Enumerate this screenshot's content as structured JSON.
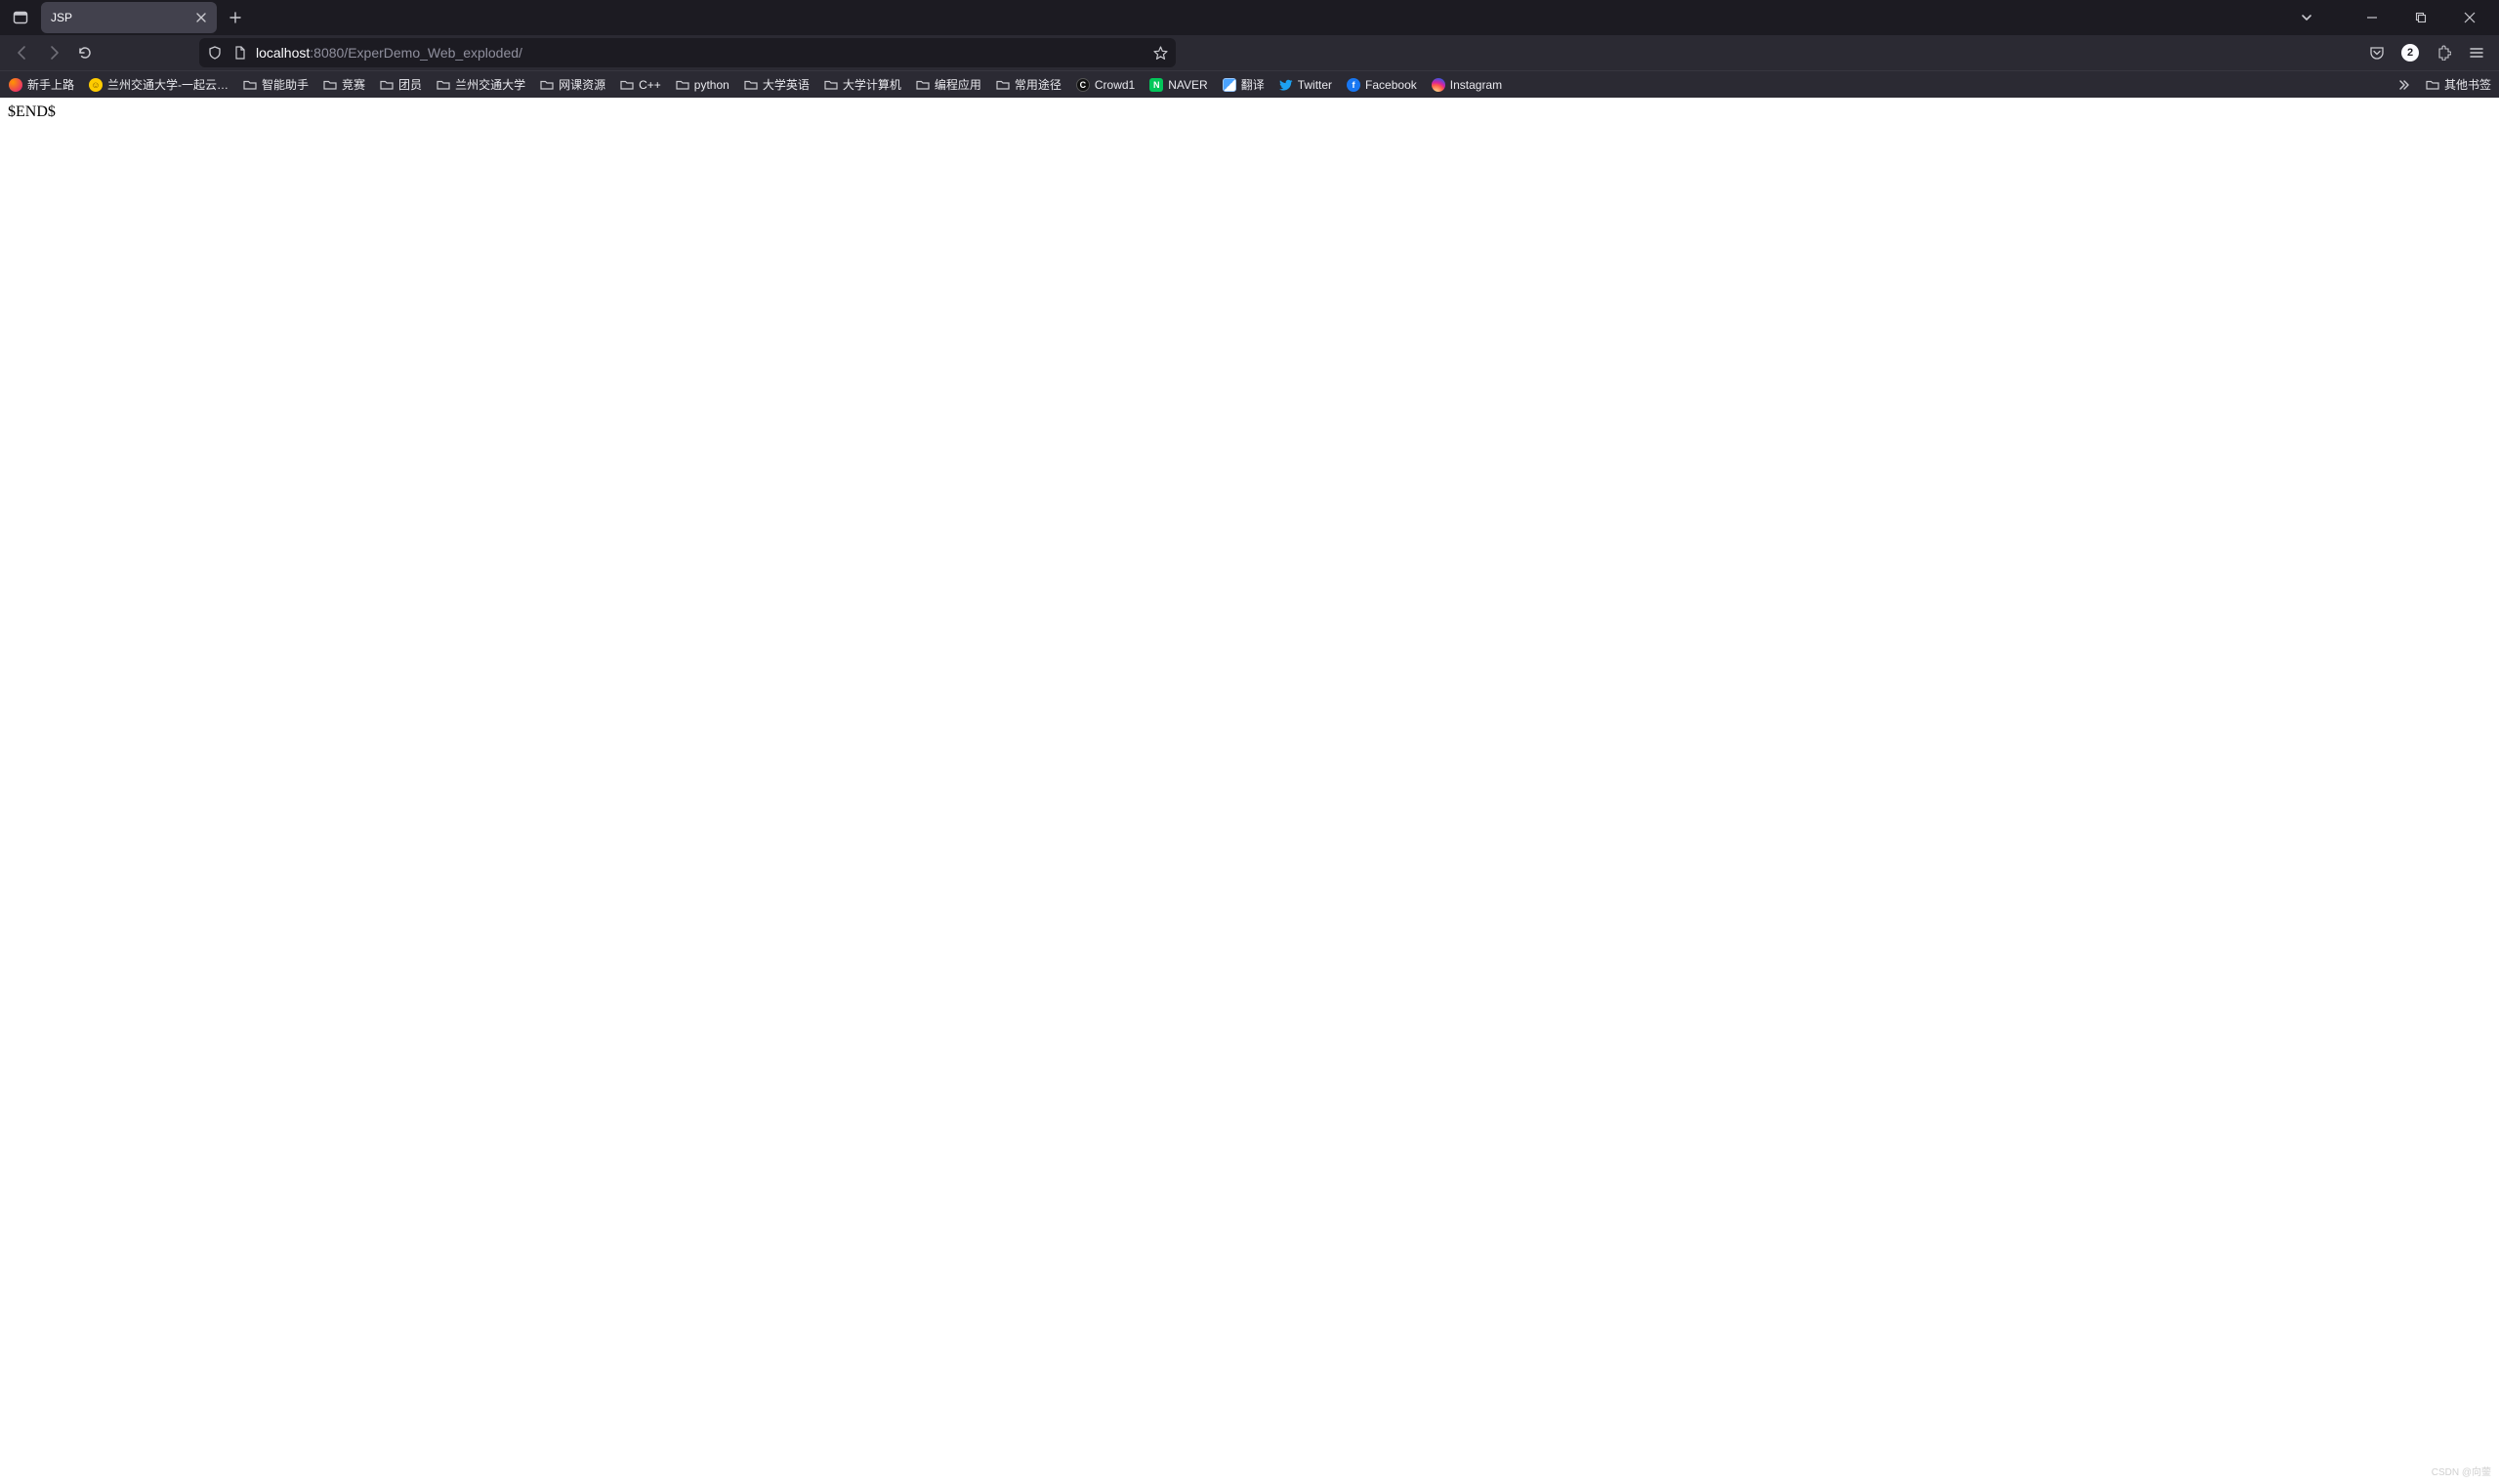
{
  "window": {
    "minimize_icon": "minimize",
    "maximize_icon": "maximize",
    "close_icon": "close"
  },
  "tab": {
    "title": "JSP"
  },
  "url": {
    "host": "localhost",
    "rest": ":8080/ExperDemo_Web_exploded/"
  },
  "navbar": {
    "account_badge": "2"
  },
  "bookmarks": [
    {
      "icon": "firefox",
      "label": "新手上路"
    },
    {
      "icon": "smile",
      "label": "兰州交通大学-一起云…"
    },
    {
      "icon": "folder",
      "label": "智能助手"
    },
    {
      "icon": "folder",
      "label": "竞赛"
    },
    {
      "icon": "folder",
      "label": "团员"
    },
    {
      "icon": "folder",
      "label": "兰州交通大学"
    },
    {
      "icon": "folder",
      "label": "网课资源"
    },
    {
      "icon": "folder",
      "label": "C++"
    },
    {
      "icon": "folder",
      "label": "python"
    },
    {
      "icon": "folder",
      "label": "大学英语"
    },
    {
      "icon": "folder",
      "label": "大学计算机"
    },
    {
      "icon": "folder",
      "label": "编程应用"
    },
    {
      "icon": "folder",
      "label": "常用途径"
    },
    {
      "icon": "crowd1",
      "label": "Crowd1"
    },
    {
      "icon": "naver",
      "label": "NAVER"
    },
    {
      "icon": "translate",
      "label": "翻译"
    },
    {
      "icon": "twitter",
      "label": "Twitter"
    },
    {
      "icon": "facebook",
      "label": "Facebook"
    },
    {
      "icon": "instagram",
      "label": "Instagram"
    }
  ],
  "bookmarks_overflow": {
    "label": "其他书签"
  },
  "page": {
    "body_text": "$END$"
  },
  "watermark": "CSDN @向蓥"
}
